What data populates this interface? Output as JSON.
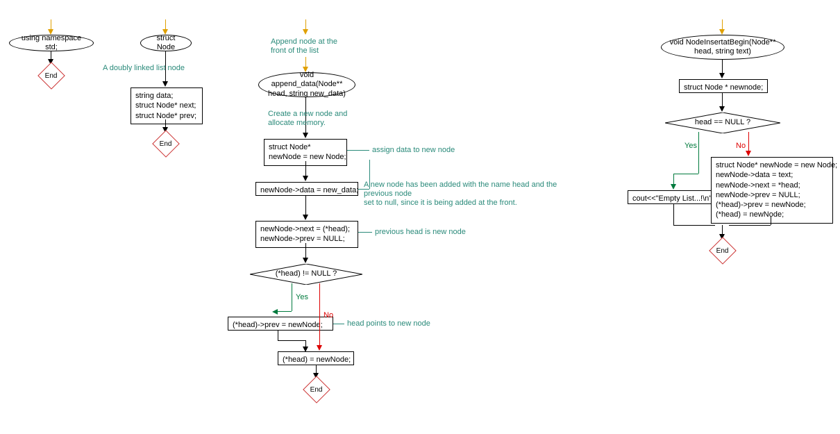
{
  "end_label": "End",
  "yes": "Yes",
  "no": "No",
  "fc1": {
    "ellipse": "using namespace std;"
  },
  "fc2": {
    "ellipse": "struct Node",
    "annot": "A doubly linked list node",
    "box": "string data;\nstruct Node* next;\nstruct Node* prev;"
  },
  "fc3": {
    "annot_top": "Append node at the\nfront of the list",
    "ellipse": "void append_data(Node**\nhead, string new_data)",
    "annot_create": "Create a new node and\nallocate memory.",
    "box_new": "struct Node*\nnewNode = new Node;",
    "annot_assign": "assign data to new node",
    "box_assign": "newNode->data = new_data;",
    "annot_addfront": "A new node has been added with the name head and the\nprevious node\nset to null, since it is being added at the front.",
    "box_nextprev": "newNode->next = (*head);\nnewNode->prev = NULL;",
    "annot_prevhead": "previous head is new node",
    "decision": "(*head) != NULL ?",
    "box_prevset": "(*head)->prev = newNode;",
    "annot_headpoints": "head points to new node",
    "box_headset": "(*head) = newNode;"
  },
  "fc4": {
    "ellipse": "void NodeInsertatBegin(Node**\nhead, string text)",
    "box_decl": "struct Node * newnode;",
    "decision": "head == NULL ?",
    "box_cout": "cout<<\"Empty List...!\\n\";",
    "box_big": "struct Node* newNode = new Node;\nnewNode->data = text;\nnewNode->next = *head;\nnewNode->prev = NULL;\n(*head)->prev = newNode;\n(*head) = newNode;"
  },
  "chart_data": {
    "type": "flowchart-set",
    "charts": [
      {
        "id": "fc1",
        "nodes": [
          {
            "id": "n1",
            "type": "terminator",
            "label": "using namespace std;"
          },
          {
            "id": "n2",
            "type": "end",
            "label": "End"
          }
        ],
        "edges": [
          {
            "from": "start",
            "to": "n1"
          },
          {
            "from": "n1",
            "to": "n2"
          }
        ]
      },
      {
        "id": "fc2",
        "nodes": [
          {
            "id": "n1",
            "type": "terminator",
            "label": "struct Node"
          },
          {
            "id": "n2",
            "type": "process",
            "label": "string data;\nstruct Node* next;\nstruct Node* prev;"
          },
          {
            "id": "n3",
            "type": "end",
            "label": "End"
          }
        ],
        "edges": [
          {
            "from": "start",
            "to": "n1"
          },
          {
            "from": "n1",
            "to": "n2",
            "annotation": "A doubly linked list node"
          },
          {
            "from": "n2",
            "to": "n3"
          }
        ]
      },
      {
        "id": "fc3",
        "nodes": [
          {
            "id": "a0",
            "type": "annotation",
            "label": "Append node at the\nfront of the list"
          },
          {
            "id": "n1",
            "type": "terminator",
            "label": "void append_data(Node** head, string new_data)"
          },
          {
            "id": "a1",
            "type": "annotation",
            "label": "Create a new node and allocate memory."
          },
          {
            "id": "n2",
            "type": "process",
            "label": "struct Node* newNode = new Node;",
            "annotation": "assign data to new node"
          },
          {
            "id": "n3",
            "type": "process",
            "label": "newNode->data = new_data;",
            "annotation": "A new node has been added with the name head and the previous node set to null, since it is being added at the front."
          },
          {
            "id": "n4",
            "type": "process",
            "label": "newNode->next = (*head);\nnewNode->prev = NULL;",
            "annotation": "previous head is new node"
          },
          {
            "id": "n5",
            "type": "decision",
            "label": "(*head) != NULL ?"
          },
          {
            "id": "n6",
            "type": "process",
            "label": "(*head)->prev = newNode;"
          },
          {
            "id": "n7",
            "type": "process",
            "label": "(*head) = newNode;",
            "annotation": "head points to new node"
          },
          {
            "id": "n8",
            "type": "end",
            "label": "End"
          }
        ],
        "edges": [
          {
            "from": "start",
            "to": "a0"
          },
          {
            "from": "a0",
            "to": "n1"
          },
          {
            "from": "n1",
            "to": "n2",
            "via": "a1"
          },
          {
            "from": "n2",
            "to": "n3"
          },
          {
            "from": "n3",
            "to": "n4"
          },
          {
            "from": "n4",
            "to": "n5"
          },
          {
            "from": "n5",
            "to": "n6",
            "label": "Yes"
          },
          {
            "from": "n5",
            "to": "n7",
            "label": "No"
          },
          {
            "from": "n6",
            "to": "n7"
          },
          {
            "from": "n7",
            "to": "n8"
          }
        ]
      },
      {
        "id": "fc4",
        "nodes": [
          {
            "id": "n1",
            "type": "terminator",
            "label": "void NodeInsertatBegin(Node** head, string text)"
          },
          {
            "id": "n2",
            "type": "process",
            "label": "struct Node * newnode;"
          },
          {
            "id": "n3",
            "type": "decision",
            "label": "head == NULL ?"
          },
          {
            "id": "n4",
            "type": "process",
            "label": "cout<<\"Empty List...!\\n\";"
          },
          {
            "id": "n5",
            "type": "process",
            "label": "struct Node* newNode = new Node;\nnewNode->data = text;\nnewNode->next = *head;\nnewNode->prev = NULL;\n(*head)->prev = newNode;\n(*head) = newNode;"
          },
          {
            "id": "n6",
            "type": "end",
            "label": "End"
          }
        ],
        "edges": [
          {
            "from": "start",
            "to": "n1"
          },
          {
            "from": "n1",
            "to": "n2"
          },
          {
            "from": "n2",
            "to": "n3"
          },
          {
            "from": "n3",
            "to": "n4",
            "label": "Yes"
          },
          {
            "from": "n3",
            "to": "n5",
            "label": "No"
          },
          {
            "from": "n4",
            "to": "n6"
          },
          {
            "from": "n5",
            "to": "n6"
          }
        ]
      }
    ]
  }
}
